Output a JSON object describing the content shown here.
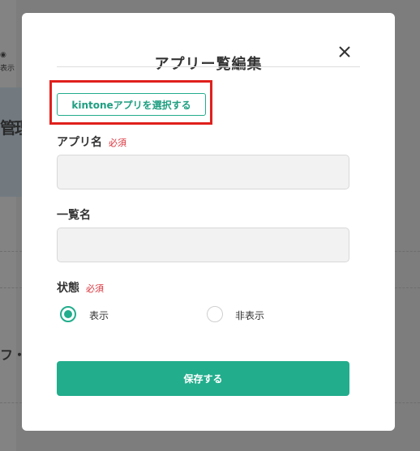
{
  "background": {
    "fragment_visibility": "表示",
    "fragment_manage": "管理",
    "fragment_dots": "フ・"
  },
  "modal": {
    "title": "アプリー覧編集",
    "close_icon": "close-icon",
    "select_app_button": "kintoneアプリを選択する",
    "app_name_label": "アプリ名",
    "required_label": "必須",
    "app_name_value": "",
    "list_name_label": "一覧名",
    "list_name_value": "",
    "status_label": "状態",
    "status_options": [
      "表示",
      "非表示"
    ],
    "status_selected": "表示",
    "save_button": "保存する"
  },
  "colors": {
    "accent": "#22ad8c",
    "required": "#d9323b",
    "highlight": "#e0201c"
  }
}
